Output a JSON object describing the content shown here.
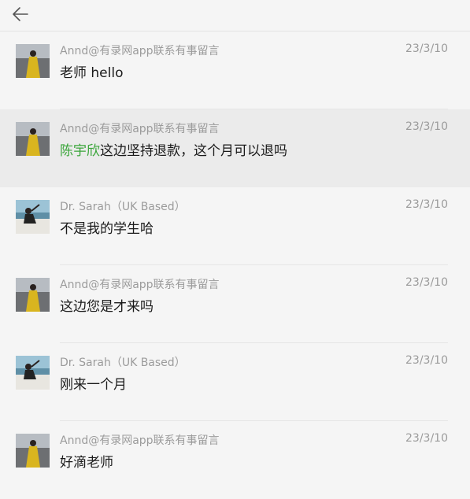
{
  "header": {
    "back_icon": "arrow-left-icon"
  },
  "messages": [
    {
      "sender": "Annd@有录网app联系有事留言",
      "time": "23/3/10",
      "text": "老师 hello",
      "avatar": "avatar-woman-yellow-dress"
    },
    {
      "sender": "Annd@有录网app联系有事留言",
      "time": "23/3/10",
      "mention": "陈宇欣",
      "text": "这边坚持退款，这个月可以退吗",
      "avatar": "avatar-woman-yellow-dress"
    },
    {
      "sender": "Dr. Sarah（UK Based）",
      "time": "23/3/10",
      "text": "不是我的学生哈",
      "avatar": "avatar-woman-boat-sea"
    },
    {
      "sender": "Annd@有录网app联系有事留言",
      "time": "23/3/10",
      "text": "这边您是才来吗",
      "avatar": "avatar-woman-yellow-dress"
    },
    {
      "sender": "Dr. Sarah（UK Based）",
      "time": "23/3/10",
      "text": "刚来一个月",
      "avatar": "avatar-woman-boat-sea"
    },
    {
      "sender": "Annd@有录网app联系有事留言",
      "time": "23/3/10",
      "text": "好滴老师",
      "avatar": "avatar-woman-yellow-dress"
    }
  ],
  "colors": {
    "background": "#f5f5f5",
    "highlight": "#ebebeb",
    "mention": "#3aa53a",
    "meta_text": "#9b9b9b"
  }
}
